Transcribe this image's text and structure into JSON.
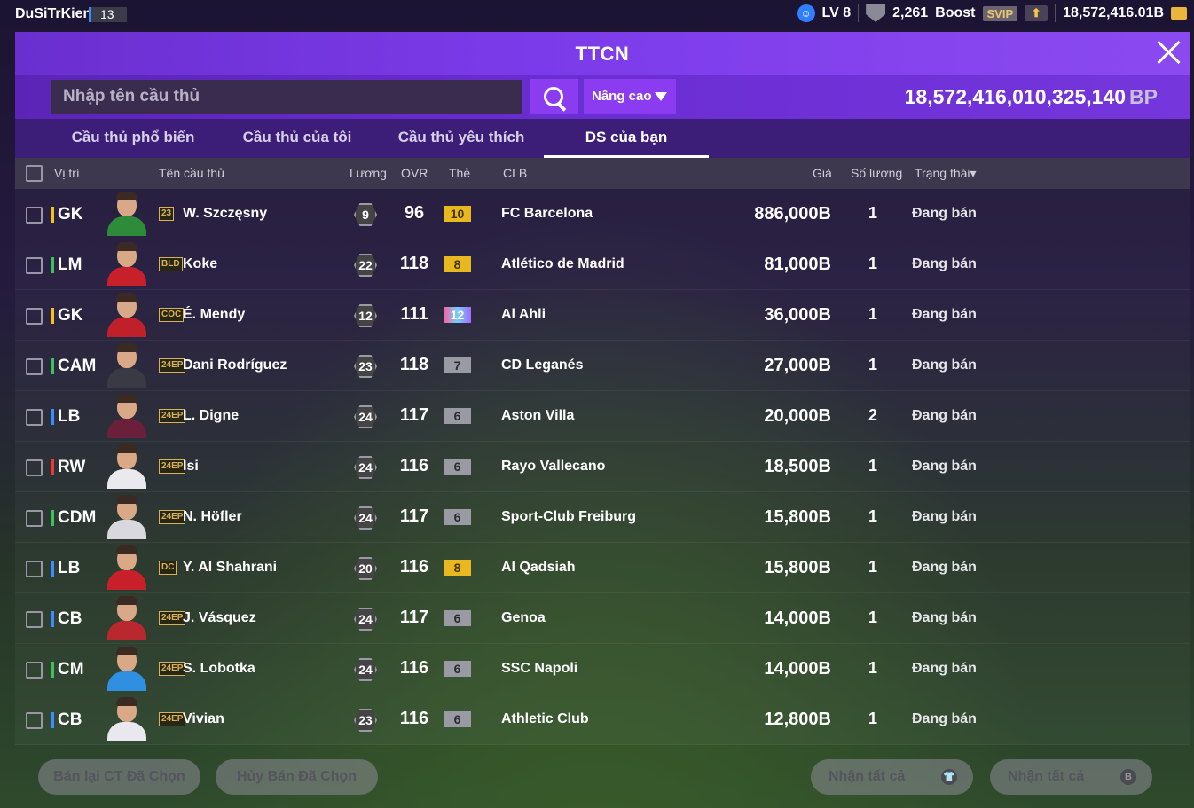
{
  "topbar": {
    "username": "DuSiTrKien",
    "user_level": "13",
    "level": "LV 8",
    "shield_count": "2,261",
    "boost_label": "Boost",
    "svip_label": "SVIP",
    "balance": "18,572,416.01B"
  },
  "header": {
    "title": "TTCN"
  },
  "search": {
    "placeholder": "Nhập tên cầu thủ",
    "advanced_label": "Nâng cao",
    "bp_value": "18,572,416,010,325,140",
    "bp_unit": "BP"
  },
  "tabs": [
    {
      "label": "Cầu thủ phổ biến",
      "active": false
    },
    {
      "label": "Cầu thủ của tôi",
      "active": false
    },
    {
      "label": "Cầu thủ yêu thích",
      "active": false
    },
    {
      "label": "DS của bạn",
      "active": true
    }
  ],
  "columns": {
    "position": "Vị trí",
    "name": "Tên cầu thủ",
    "wage": "Lương",
    "ovr": "OVR",
    "card": "Thẻ",
    "club": "CLB",
    "price": "Giá",
    "qty": "Số lượng",
    "status": "Trạng thái"
  },
  "rows": [
    {
      "pos": "GK",
      "pos_color": "#f2c21a",
      "badge": "23",
      "name": "W. Szczęsny",
      "wage": "9",
      "ovr": "96",
      "card": "10",
      "card_style": "gold",
      "club": "FC Barcelona",
      "price": "886,000B",
      "qty": "1",
      "status": "Đang bán",
      "shirt": "#2e8b3a"
    },
    {
      "pos": "LM",
      "pos_color": "#3ac35a",
      "badge": "BLD",
      "name": "Koke",
      "wage": "22",
      "ovr": "118",
      "card": "8",
      "card_style": "gold",
      "club": "Atlético de Madrid",
      "price": "81,000B",
      "qty": "1",
      "status": "Đang bán",
      "shirt": "#c8202a"
    },
    {
      "pos": "GK",
      "pos_color": "#f2c21a",
      "badge": "COC",
      "name": "É. Mendy",
      "wage": "12",
      "ovr": "111",
      "card": "12",
      "card_style": "rainbow",
      "club": "Al Ahli",
      "price": "36,000B",
      "qty": "1",
      "status": "Đang bán",
      "shirt": "#c0202a"
    },
    {
      "pos": "CAM",
      "pos_color": "#3ac35a",
      "badge": "24EP",
      "name": "Dani Rodríguez",
      "wage": "23",
      "ovr": "118",
      "card": "7",
      "card_style": "silver",
      "club": "CD Leganés",
      "price": "27,000B",
      "qty": "1",
      "status": "Đang bán",
      "shirt": "#3a3a44"
    },
    {
      "pos": "LB",
      "pos_color": "#3a8cff",
      "badge": "24EP",
      "name": "L. Digne",
      "wage": "24",
      "ovr": "117",
      "card": "6",
      "card_style": "silver",
      "club": "Aston Villa",
      "price": "20,000B",
      "qty": "2",
      "status": "Đang bán",
      "shirt": "#6a1f3a"
    },
    {
      "pos": "RW",
      "pos_color": "#e83a3a",
      "badge": "24EP",
      "name": "Isi",
      "wage": "24",
      "ovr": "116",
      "card": "6",
      "card_style": "silver",
      "club": "Rayo Vallecano",
      "price": "18,500B",
      "qty": "1",
      "status": "Đang bán",
      "shirt": "#e9e9ee"
    },
    {
      "pos": "CDM",
      "pos_color": "#3ac35a",
      "badge": "24EP",
      "name": "N. Höfler",
      "wage": "24",
      "ovr": "117",
      "card": "6",
      "card_style": "silver",
      "club": "Sport-Club Freiburg",
      "price": "15,800B",
      "qty": "1",
      "status": "Đang bán",
      "shirt": "#d8d8de"
    },
    {
      "pos": "LB",
      "pos_color": "#3a8cff",
      "badge": "DC",
      "name": "Y. Al Shahrani",
      "wage": "20",
      "ovr": "116",
      "card": "8",
      "card_style": "gold",
      "club": "Al Qadsiah",
      "price": "15,800B",
      "qty": "1",
      "status": "Đang bán",
      "shirt": "#c8202a"
    },
    {
      "pos": "CB",
      "pos_color": "#3a8cff",
      "badge": "24EP",
      "name": "J. Vásquez",
      "wage": "24",
      "ovr": "117",
      "card": "6",
      "card_style": "silver",
      "club": "Genoa",
      "price": "14,000B",
      "qty": "1",
      "status": "Đang bán",
      "shirt": "#b8282e"
    },
    {
      "pos": "CM",
      "pos_color": "#3ac35a",
      "badge": "24EP",
      "name": "S. Lobotka",
      "wage": "24",
      "ovr": "116",
      "card": "6",
      "card_style": "silver",
      "club": "SSC Napoli",
      "price": "14,000B",
      "qty": "1",
      "status": "Đang bán",
      "shirt": "#2f8fe0"
    },
    {
      "pos": "CB",
      "pos_color": "#3a8cff",
      "badge": "24EP",
      "name": "Vivian",
      "wage": "23",
      "ovr": "116",
      "card": "6",
      "card_style": "silver",
      "club": "Athletic Club",
      "price": "12,800B",
      "qty": "1",
      "status": "Đang bán",
      "shirt": "#e8e8ee"
    }
  ],
  "footer": {
    "resell_label": "Bán lại CT Đã Chọn",
    "cancel_label": "Hủy Bán Đã Chọn",
    "claim_items_label": "Nhận tất cả",
    "claim_bp_label": "Nhận tất cả"
  }
}
